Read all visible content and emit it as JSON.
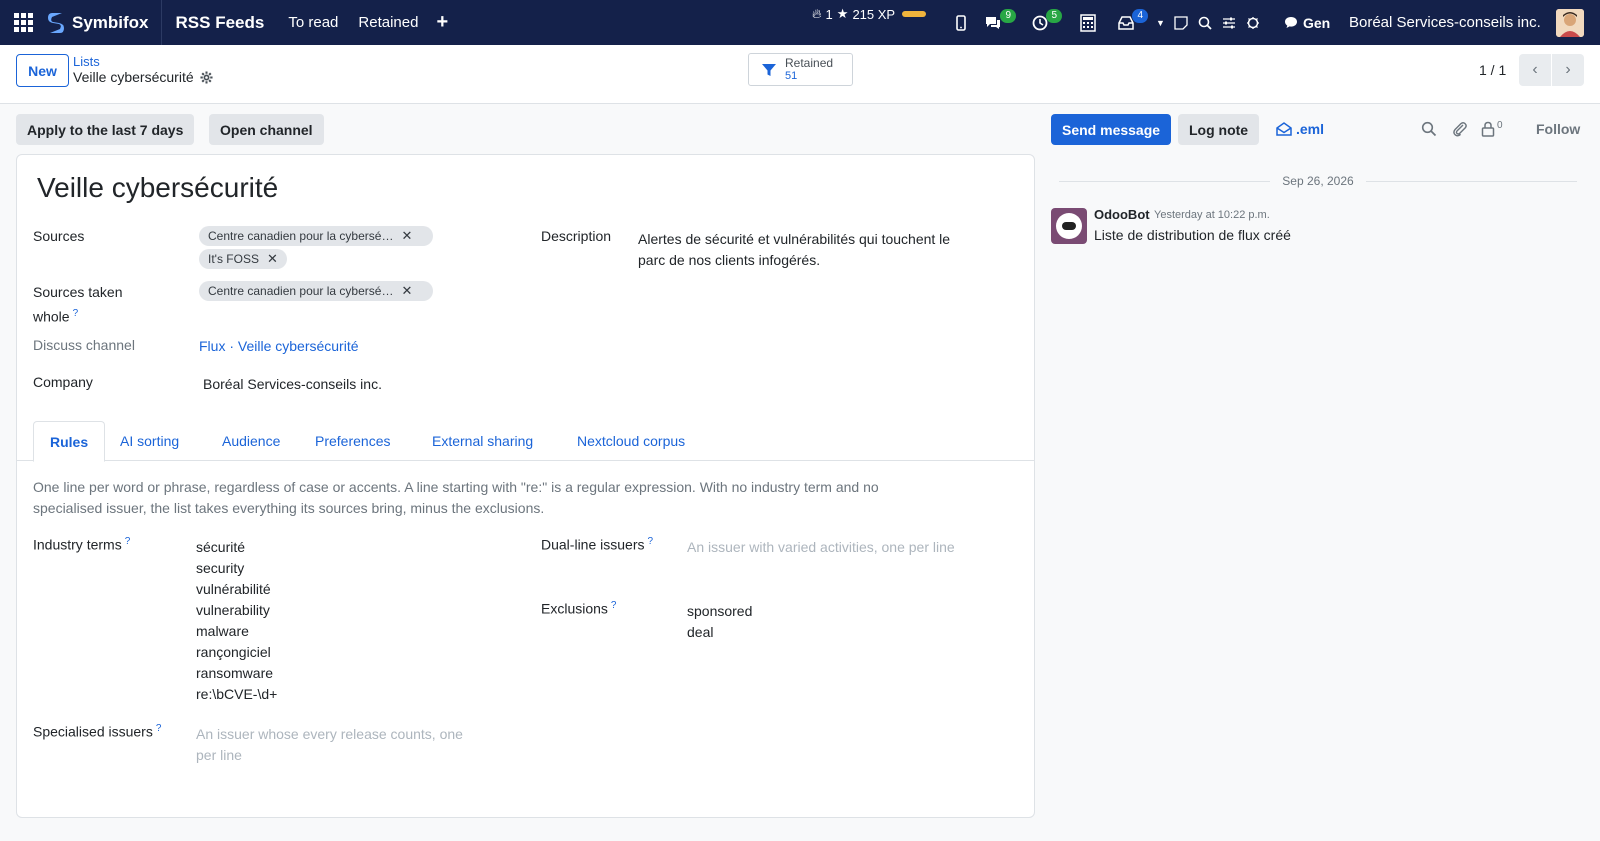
{
  "navbar": {
    "brand": "Symbifox",
    "app_title": "RSS Feeds",
    "menu": [
      "To read",
      "Retained"
    ],
    "plus": "+",
    "streak": "1",
    "xp": "215 XP",
    "badges": {
      "messages": "9",
      "activities": "5",
      "notifications": "4"
    },
    "gen_label": "Gen",
    "company": "Boréal Services-conseils inc."
  },
  "control": {
    "new_label": "New",
    "breadcrumb_parent": "Lists",
    "breadcrumb_current": "Veille cybersécurité",
    "filter_label": "Retained",
    "filter_count": "51",
    "pager": "1 / 1"
  },
  "form": {
    "actions": [
      "Apply to the last 7 days",
      "Open channel"
    ],
    "title": "Veille cybersécurité",
    "labels": {
      "sources": "Sources",
      "sources_whole_1": "Sources taken",
      "sources_whole_2": "whole",
      "discuss_channel": "Discuss channel",
      "company": "Company",
      "description": "Description"
    },
    "sources": [
      "Centre canadien pour la cybersé…",
      "It's FOSS"
    ],
    "sources_whole": [
      "Centre canadien pour la cybersé…"
    ],
    "discuss_channel": "Flux · Veille cybersécurité",
    "company": "Boréal Services-conseils inc.",
    "description_lines": [
      "Alertes de sécurité et vulnérabilités qui touchent le",
      "parc de nos clients infogérés."
    ],
    "tabs": [
      "Rules",
      "AI sorting",
      "Audience",
      "Preferences",
      "External sharing",
      "Nextcloud corpus"
    ],
    "hint_lines": [
      "One line per word or phrase, regardless of case or accents. A line starting with \"re:\" is a regular expression. With no industry term and no",
      "specialised issuer, the list takes everything its sources bring, minus the exclusions."
    ],
    "industry_terms_label": "Industry terms",
    "industry_terms": [
      "sécurité",
      "security",
      "vulnérabilité",
      "vulnerability",
      "malware",
      "rançongiciel",
      "ransomware",
      "re:\\bCVE-\\d+"
    ],
    "specialised_label": "Specialised issuers",
    "specialised_placeholder": [
      "An issuer whose every release counts, one",
      "per line"
    ],
    "dual_label": "Dual-line issuers",
    "dual_placeholder": "An issuer with varied activities, one per line",
    "exclusions_label": "Exclusions",
    "exclusions": [
      "sponsored",
      "deal"
    ],
    "help_mark": "?"
  },
  "chatter": {
    "send_message": "Send message",
    "log_note": "Log note",
    "eml": ".eml",
    "followers_count": "0",
    "follow": "Follow",
    "date": "Sep 26, 2026",
    "author": "OdooBot",
    "time": "Yesterday at 10:22 p.m.",
    "body": "Liste de distribution de flux créé"
  },
  "colors": {
    "navbar": "#14214a",
    "primary": "#1b64d8",
    "badge_green": "#28a745"
  }
}
